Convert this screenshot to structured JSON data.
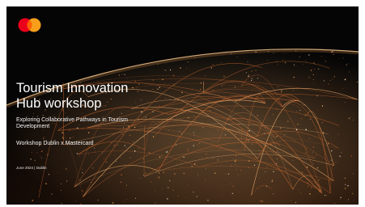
{
  "slide": {
    "title_line1": "Tourism Innovation",
    "title_line2": "Hub workshop",
    "subtitle": "Exploring Collaborative Pathways in Tourism Development",
    "workshop_line": "Workshop Dublin x Mastercard",
    "date_line": "June 2024 | Dublin"
  },
  "logo": {
    "icon": "mastercard-logo",
    "colors": {
      "left_circle": "#eb001b",
      "right_circle": "#f79e1b",
      "overlap": "#ff5f00"
    }
  },
  "background": {
    "icon": "globe-network-image",
    "colors": {
      "base": "#050505",
      "glow": "#f2a65a",
      "lines": "#d9773a",
      "highlight": "#fff1d6"
    }
  }
}
